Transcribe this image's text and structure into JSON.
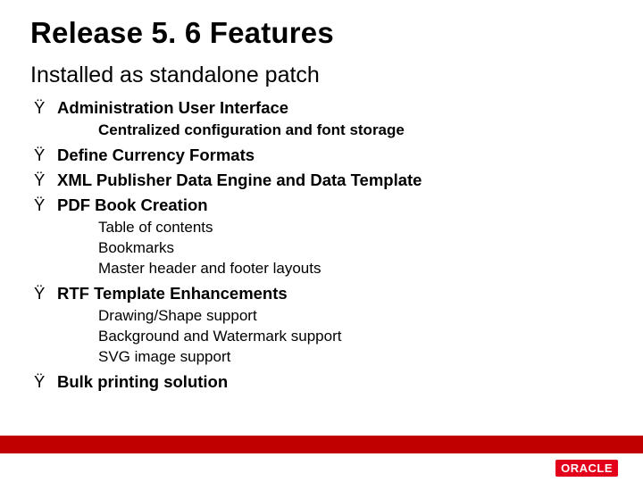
{
  "title": "Release 5. 6 Features",
  "subtitle": "Installed as standalone patch",
  "bullet_char": "Ÿ",
  "items": [
    {
      "label": "Administration User Interface",
      "subs": [
        {
          "text": "Centralized configuration and font storage",
          "bold": true
        }
      ]
    },
    {
      "label": "Define Currency Formats",
      "subs": []
    },
    {
      "label": "XML Publisher Data Engine and Data Template",
      "subs": []
    },
    {
      "label": "PDF Book Creation",
      "subs": [
        {
          "text": "Table of contents",
          "bold": false
        },
        {
          "text": "Bookmarks",
          "bold": false
        },
        {
          "text": "Master header and footer layouts",
          "bold": false
        }
      ]
    },
    {
      "label": "RTF Template Enhancements",
      "subs": [
        {
          "text": "Drawing/Shape support",
          "bold": false
        },
        {
          "text": "Background and Watermark support",
          "bold": false
        },
        {
          "text": "SVG image support",
          "bold": false
        }
      ]
    },
    {
      "label": "Bulk printing solution",
      "subs": []
    }
  ],
  "logo_text": "ORACLE"
}
